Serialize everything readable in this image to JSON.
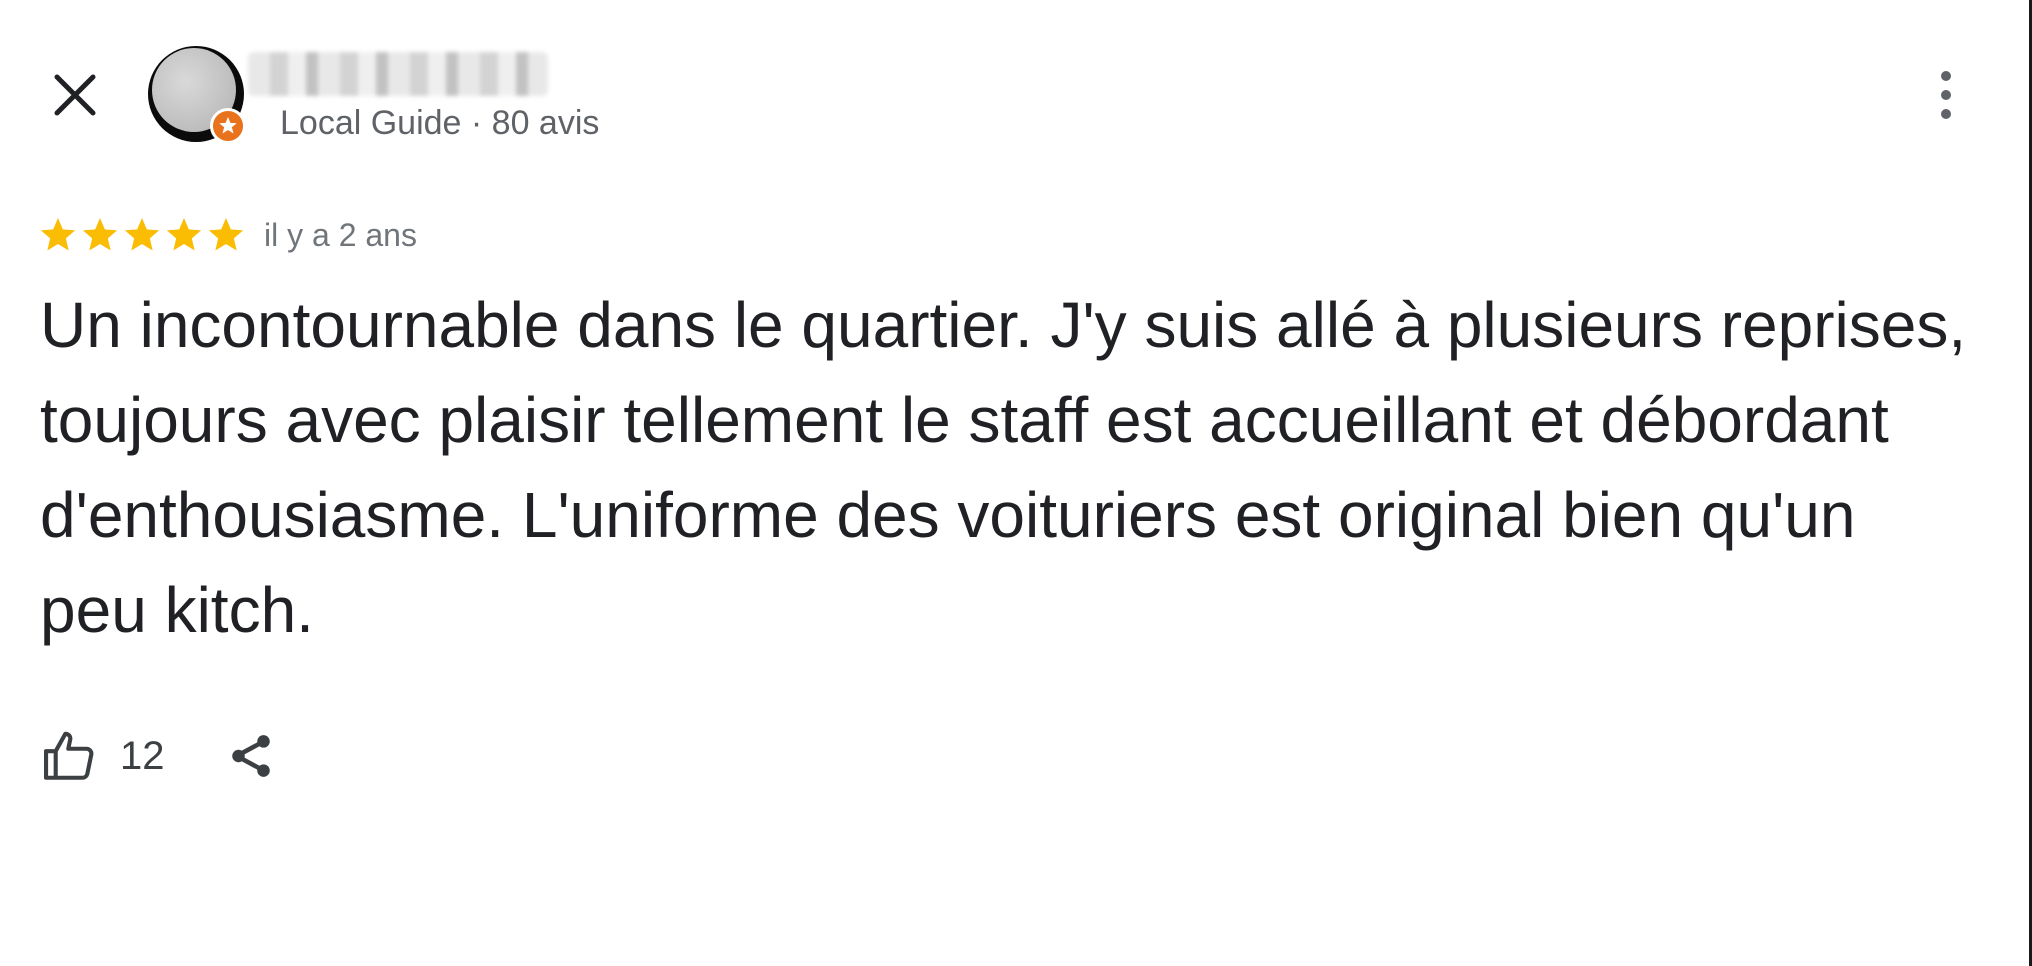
{
  "header": {
    "close_icon": "close-icon",
    "avatar_icon": "avatar-icon",
    "badge_icon": "local-guide-star-icon",
    "reviewer_meta": "Local Guide · 80 avis",
    "more_icon": "more-vert-icon"
  },
  "review": {
    "stars": 5,
    "star_color": "#fbbc04",
    "time_ago": "il y a 2 ans",
    "text": "Un incontournable dans le quartier. J'y suis allé à plusieurs reprises, toujours avec plaisir tellement le staff est accueillant et débordant d'enthousiasme. L'uniforme des voituriers est original bien qu'un peu kitch."
  },
  "actions": {
    "like_icon": "thumb-up-icon",
    "like_count": "12",
    "share_icon": "share-icon"
  },
  "colors": {
    "text_primary": "#202124",
    "text_secondary": "#5f6368",
    "badge_orange": "#e8731c"
  }
}
